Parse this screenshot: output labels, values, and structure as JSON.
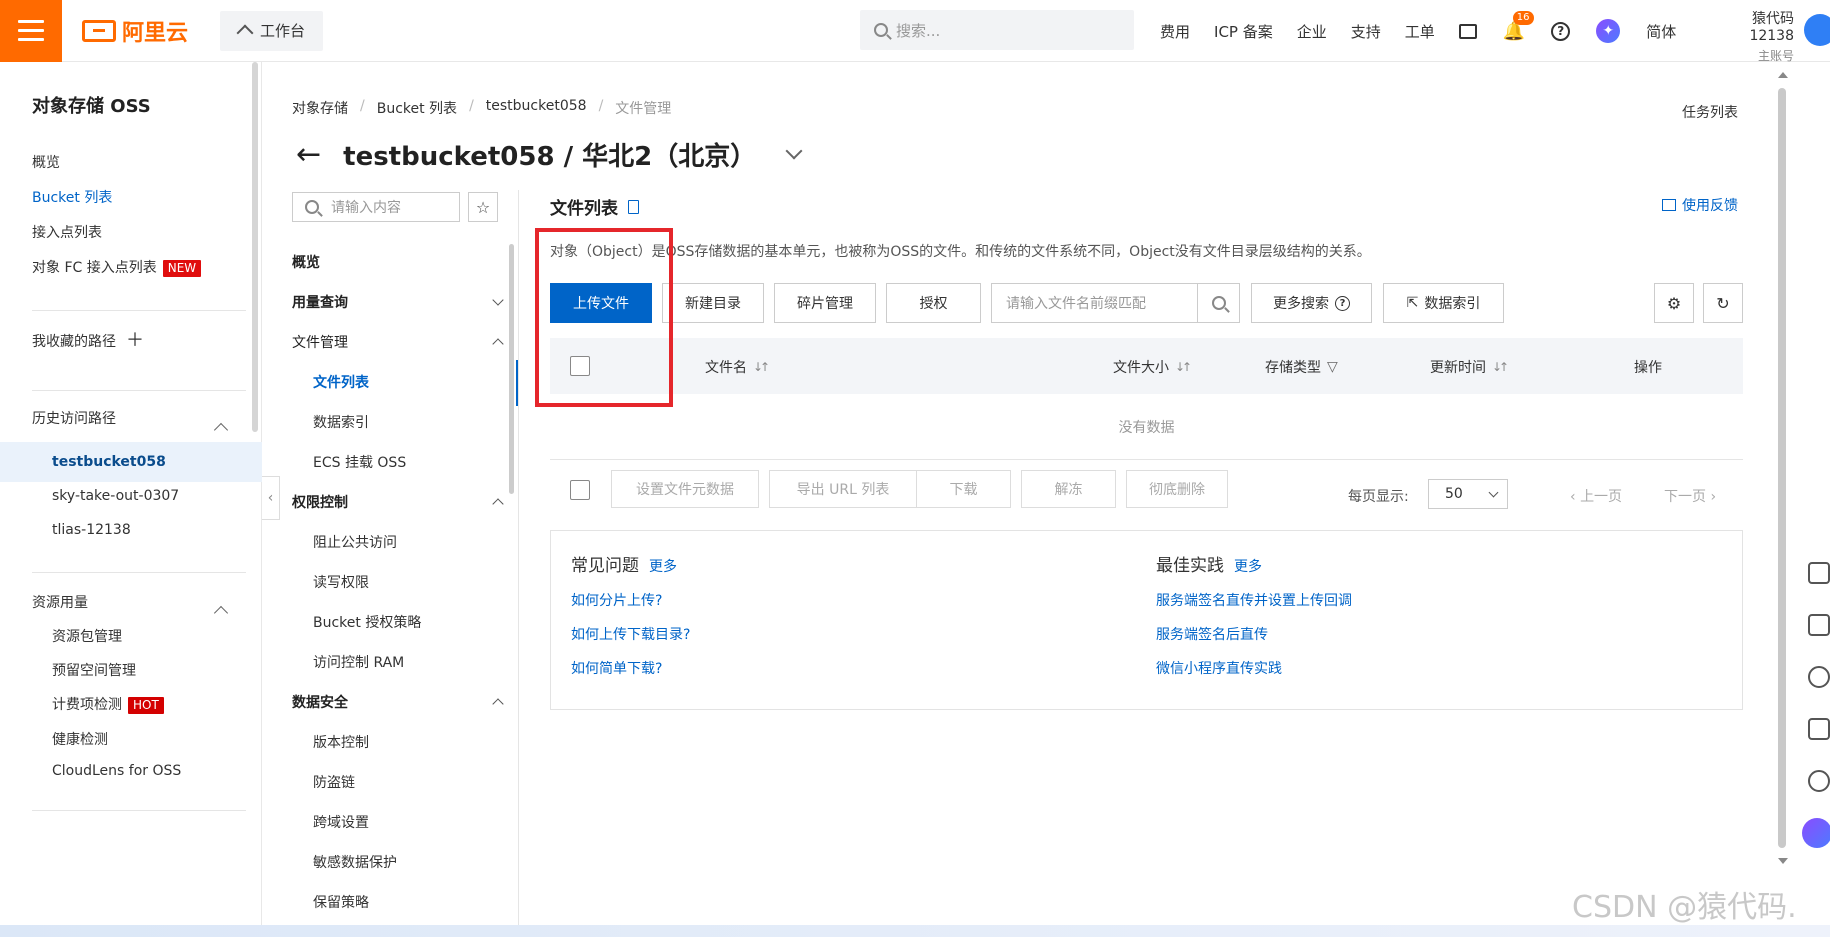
{
  "topbar": {
    "logo": "阿里云",
    "workbench": "工作台",
    "search_placeholder": "搜索...",
    "nav": [
      "费用",
      "ICP 备案",
      "企业",
      "支持",
      "工单"
    ],
    "notification_count": "16",
    "lang": "简体",
    "user_name": "猿代码12138",
    "user_role": "主账号"
  },
  "sidebar": {
    "title": "对象存储 OSS",
    "items": [
      {
        "label": "概览"
      },
      {
        "label": "Bucket 列表"
      },
      {
        "label": "接入点列表"
      },
      {
        "label": "对象 FC 接入点列表",
        "tag": "NEW"
      }
    ],
    "favorites": "我收藏的路径",
    "history_title": "历史访问路径",
    "history": [
      "testbucket058",
      "sky-take-out-0307",
      "tlias-12138"
    ],
    "resource_title": "资源用量",
    "resources": [
      {
        "label": "资源包管理"
      },
      {
        "label": "预留空间管理"
      },
      {
        "label": "计费项检测",
        "tag": "HOT"
      },
      {
        "label": "健康检测"
      },
      {
        "label": "CloudLens for OSS"
      }
    ]
  },
  "breadcrumb": [
    "对象存储",
    "Bucket 列表",
    "testbucket058",
    "文件管理"
  ],
  "task_list": "任务列表",
  "page_title": "testbucket058 / 华北2（北京）",
  "inner_menu": {
    "search_placeholder": "请输入内容",
    "groups": [
      {
        "label": "概览"
      },
      {
        "label": "用量查询"
      },
      {
        "label": "文件管理",
        "items": [
          "文件列表",
          "数据索引",
          "ECS 挂载 OSS"
        ]
      },
      {
        "label": "权限控制",
        "items": [
          "阻止公共访问",
          "读写权限",
          "Bucket 授权策略",
          "访问控制 RAM"
        ]
      },
      {
        "label": "数据安全",
        "items": [
          "版本控制",
          "防盗链",
          "跨域设置",
          "敏感数据保护",
          "保留策略"
        ]
      }
    ]
  },
  "main": {
    "section_title": "文件列表",
    "feedback": "使用反馈",
    "description": "对象（Object）是OSS存储数据的基本单元，也被称为OSS的文件。和传统的文件系统不同，Object没有文件目录层级结构的关系。",
    "buttons": {
      "upload": "上传文件",
      "new_dir": "新建目录",
      "fragments": "碎片管理",
      "authorize": "授权",
      "more_search": "更多搜索",
      "data_index": "数据索引"
    },
    "file_search_placeholder": "请输入文件名前缀匹配",
    "columns": [
      "文件名",
      "文件大小",
      "存储类型",
      "更新时间",
      "操作"
    ],
    "no_data": "没有数据",
    "bulk_actions": [
      "设置文件元数据",
      "导出 URL 列表",
      "下载",
      "解冻",
      "彻底删除"
    ],
    "pager": {
      "label": "每页显示:",
      "page_size": "50",
      "prev": "上一页",
      "next": "下一页"
    },
    "faq": {
      "title": "常见问题",
      "more": "更多",
      "links": [
        "如何分片上传?",
        "如何上传下载目录?",
        "如何简单下载?"
      ]
    },
    "best_practice": {
      "title": "最佳实践",
      "more": "更多",
      "links": [
        "服务端签名直传并设置上传回调",
        "服务端签名后直传",
        "微信小程序直传实践"
      ]
    }
  },
  "watermark": "CSDN @猿代码.",
  "colors": {
    "brand_orange": "#ff6a00",
    "primary_blue": "#0064c8",
    "annotation_red": "#e5262b"
  }
}
